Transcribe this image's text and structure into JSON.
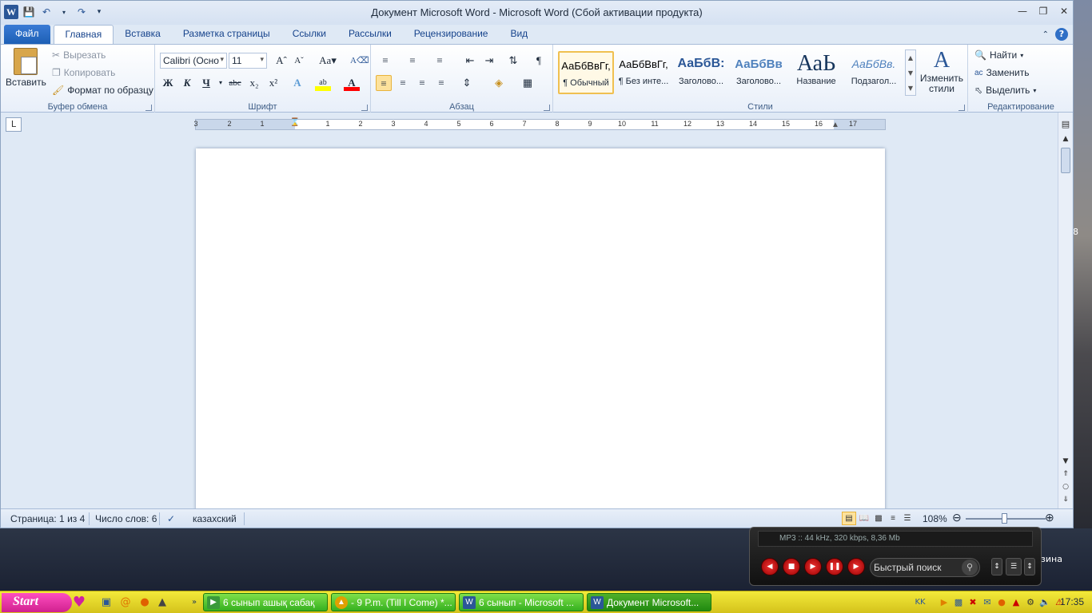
{
  "window": {
    "title": "Документ Microsoft Word  -  Microsoft Word (Сбой активации продукта)"
  },
  "tabs": [
    {
      "label": "Файл"
    },
    {
      "label": "Главная"
    },
    {
      "label": "Вставка"
    },
    {
      "label": "Разметка страницы"
    },
    {
      "label": "Ссылки"
    },
    {
      "label": "Рассылки"
    },
    {
      "label": "Рецензирование"
    },
    {
      "label": "Вид"
    }
  ],
  "clipboard": {
    "label": "Буфер обмена",
    "paste": "Вставить",
    "cut": "Вырезать",
    "copy": "Копировать",
    "format_painter": "Формат по образцу"
  },
  "font": {
    "label": "Шрифт",
    "name": "Calibri (Осно",
    "size": "11",
    "bold": "Ж",
    "italic": "К",
    "underline": "Ч",
    "strike": "abc"
  },
  "paragraph": {
    "label": "Абзац"
  },
  "styles": {
    "label": "Стили",
    "change": "Изменить стили",
    "items": [
      {
        "sample": "АаБбВвГг,",
        "name": "¶ Обычный"
      },
      {
        "sample": "АаБбВвГг,",
        "name": "¶ Без инте..."
      },
      {
        "sample": "АаБбВ:",
        "name": "Заголово..."
      },
      {
        "sample": "АаБбВв",
        "name": "Заголово..."
      },
      {
        "sample": "АаЬ",
        "name": "Название"
      },
      {
        "sample": "АаБбВв.",
        "name": "Подзагол..."
      }
    ]
  },
  "editing": {
    "label": "Редактирование",
    "find": "Найти",
    "replace": "Заменить",
    "select": "Выделить"
  },
  "ruler": {
    "numbers": [
      "3",
      "2",
      "1",
      "1",
      "2",
      "3",
      "4",
      "5",
      "6",
      "7",
      "8",
      "9",
      "10",
      "11",
      "12",
      "13",
      "14",
      "15",
      "16",
      "17"
    ]
  },
  "status": {
    "page": "Страница: 1 из 4",
    "words": "Число слов: 6",
    "language": "казахский",
    "zoom": "108%"
  },
  "desktop": {
    "label_right_1": "8",
    "label_right_2": "зина"
  },
  "player": {
    "info": "MP3 :: 44 kHz, 320 kbps, 8,36 Mb",
    "search": "Быстрый поиск"
  },
  "taskbar": {
    "start": "Start",
    "tasks": [
      {
        "label": "6 сынып ашық сабақ"
      },
      {
        "label": "- 9 P.m. (Till I Come) *..."
      },
      {
        "label": "6 сынып - Microsoft ..."
      },
      {
        "label": "Документ Microsoft..."
      }
    ],
    "clock": "17:35"
  }
}
